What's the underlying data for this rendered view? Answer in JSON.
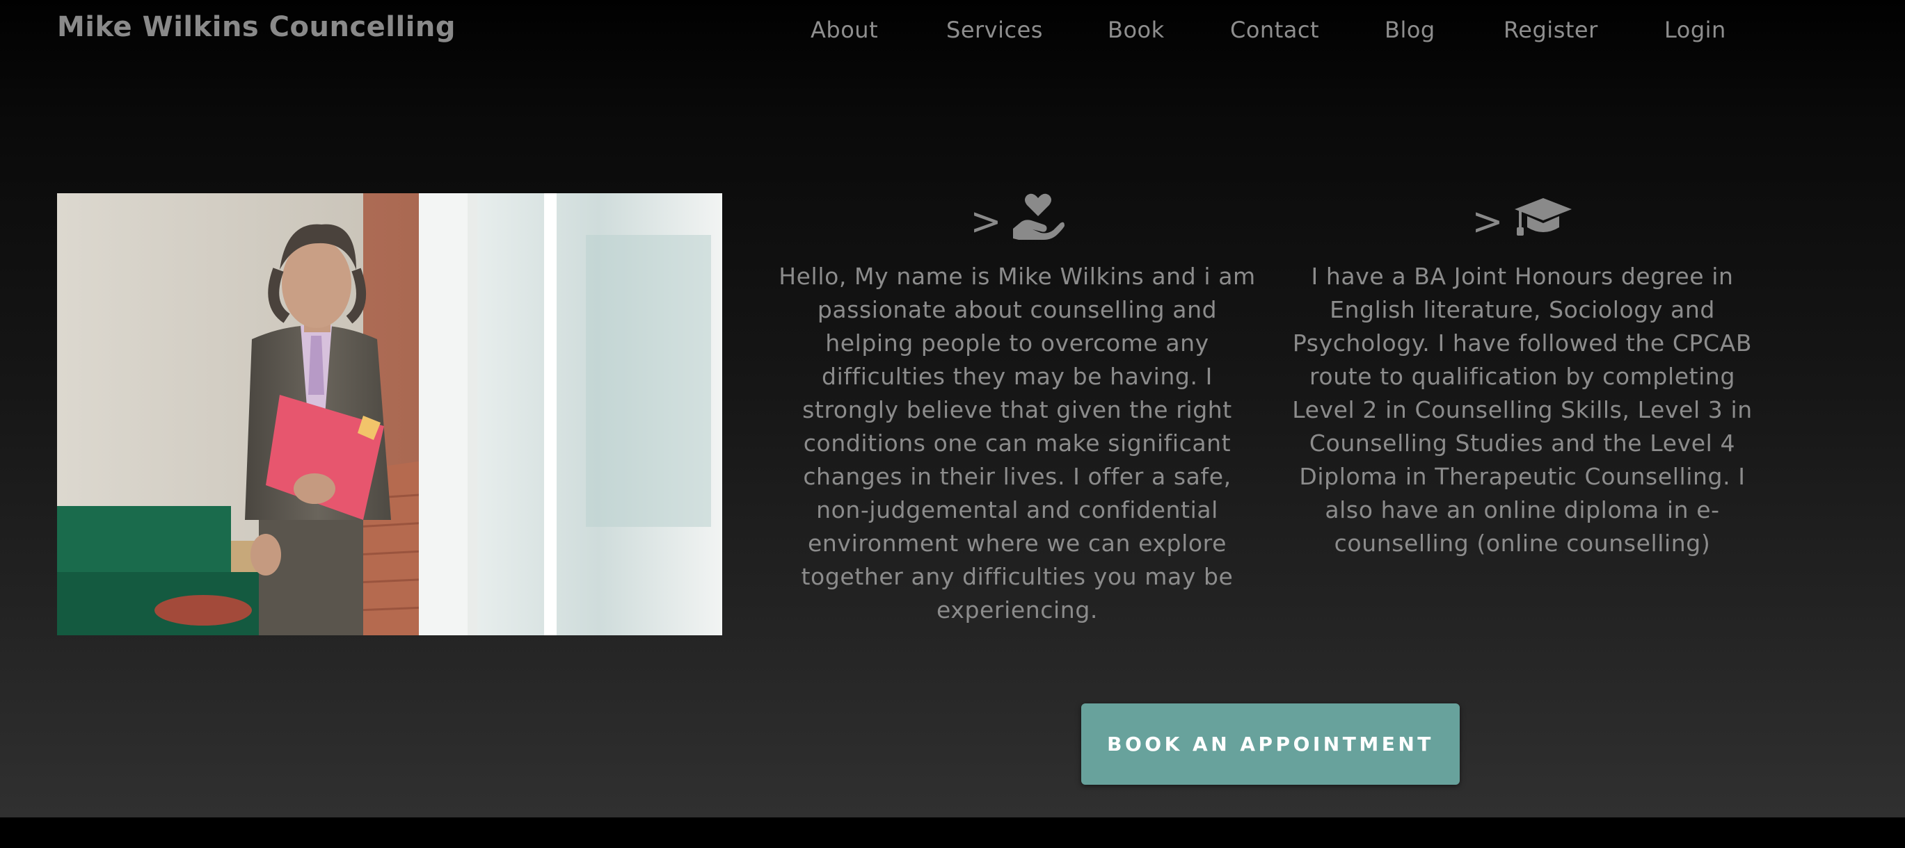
{
  "header": {
    "brand": "Mike Wilkins Councelling",
    "nav": [
      {
        "label": "About"
      },
      {
        "label": "Services"
      },
      {
        "label": "Book"
      },
      {
        "label": "Contact"
      },
      {
        "label": "Blog"
      },
      {
        "label": "Register"
      },
      {
        "label": "Login"
      }
    ]
  },
  "hero": {
    "photo_alt": "Photo of a smiling man in a suit holding a pink folder beside a window"
  },
  "columns": [
    {
      "chevron": ">",
      "icon": "hand-holding-heart-icon",
      "text": "Hello, My name is Mike Wilkins and i am passionate about counselling and helping people to overcome any difficulties they may be having. I strongly believe that given the right conditions one can make significant changes in their lives. I offer a safe, non-judgemental and confidential environment where we can explore together any difficulties you may be experiencing."
    },
    {
      "chevron": ">",
      "icon": "graduation-cap-icon",
      "text": "I have a BA Joint Honours degree in English literature, Sociology and Psychology. I have followed the CPCAB route to qualification by completing Level 2 in Counselling Skills, Level 3 in Counselling Studies and the Level 4 Diploma in Therapeutic Counselling. I also have an online diploma in e-counselling (online counselling)"
    }
  ],
  "cta": {
    "label": "BOOK AN APPOINTMENT"
  },
  "colors": {
    "background_top": "#010101",
    "background_bottom": "#303030",
    "text_muted": "#8c8c8c",
    "accent": "#68a29c"
  }
}
